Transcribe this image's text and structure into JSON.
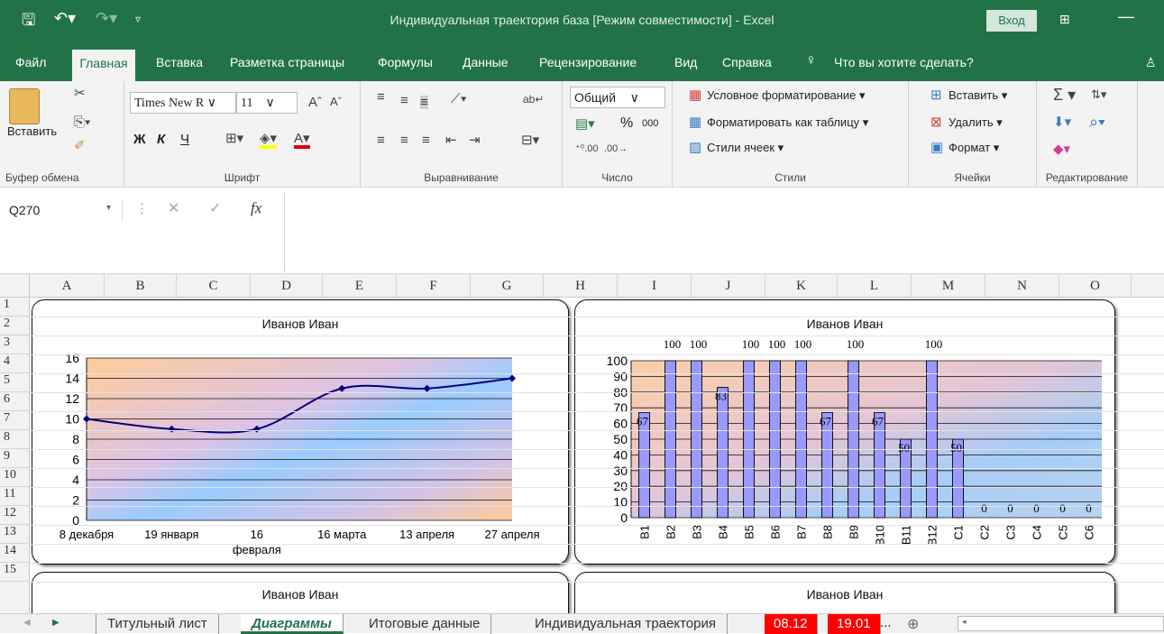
{
  "titlebar": {
    "title": "Индивидуальная траектория база  [Режим совместимости]  -  Excel",
    "login": "Вход"
  },
  "menu": {
    "file": "Файл",
    "home": "Главная",
    "insert": "Вставка",
    "layout": "Разметка страницы",
    "formulas": "Формулы",
    "data": "Данные",
    "review": "Рецензирование",
    "view": "Вид",
    "help": "Справка",
    "tell": "Что вы хотите сделать?"
  },
  "ribbon": {
    "clipboard": {
      "paste": "Вставить",
      "label": "Буфер обмена"
    },
    "font": {
      "name": "Times New R",
      "size": "11",
      "label": "Шрифт",
      "bold": "Ж",
      "italic": "К",
      "underline": "Ч"
    },
    "alignment": {
      "label": "Выравнивание"
    },
    "number": {
      "format": "Общий",
      "label": "Число",
      "percent": "%",
      "thousands": "000"
    },
    "styles": {
      "conditional": "Условное форматирование",
      "table": "Форматировать как таблицу",
      "cell": "Стили ячеек",
      "label": "Стили"
    },
    "cells": {
      "insert": "Вставить",
      "delete": "Удалить",
      "format": "Формат",
      "label": "Ячейки"
    },
    "editing": {
      "label": "Редактирование"
    }
  },
  "formula_bar": {
    "name_box": "Q270",
    "fx": "fx",
    "value": ""
  },
  "columns": [
    "A",
    "B",
    "C",
    "D",
    "E",
    "F",
    "G",
    "H",
    "I",
    "J",
    "K",
    "L",
    "M",
    "N",
    "O"
  ],
  "rows": [
    "1",
    "2",
    "3",
    "4",
    "5",
    "6",
    "7",
    "8",
    "9",
    "10",
    "11",
    "12",
    "13",
    "14",
    "15"
  ],
  "sheets": {
    "tabs": [
      "Титульный лист",
      "Диаграммы",
      "Итоговые данные",
      "Индивидуальная траектория"
    ],
    "active": "Диаграммы",
    "red_tabs": [
      "08.12",
      "19.01"
    ],
    "more": "..."
  },
  "chart_data": [
    {
      "type": "line",
      "title": "Иванов Иван",
      "categories": [
        "8 декабря",
        "19 января",
        "16 февраля",
        "16 марта",
        "13 апреля",
        "27 апреля"
      ],
      "values": [
        10,
        9,
        9,
        13,
        13,
        14
      ],
      "ylim": [
        0,
        16
      ],
      "yticks": [
        0,
        2,
        4,
        6,
        8,
        10,
        12,
        14,
        16
      ],
      "grid": true,
      "color": "#000080"
    },
    {
      "type": "bar",
      "title": "Иванов Иван",
      "categories": [
        "B1",
        "B2",
        "B3",
        "B4",
        "B5",
        "B6",
        "B7",
        "B8",
        "B9",
        "B10",
        "B11",
        "B12",
        "C1",
        "C2",
        "C3",
        "C4",
        "C5",
        "C6"
      ],
      "values": [
        67,
        100,
        100,
        83,
        100,
        100,
        100,
        67,
        100,
        67,
        50,
        100,
        50,
        0,
        0,
        0,
        0,
        0
      ],
      "ylim": [
        0,
        100
      ],
      "yticks": [
        0,
        10,
        20,
        30,
        40,
        50,
        60,
        70,
        80,
        90,
        100
      ],
      "grid": true,
      "color": "#9999ff"
    },
    {
      "type": "line",
      "title": "Иванов Иван"
    },
    {
      "type": "bar",
      "title": "Иванов Иван"
    }
  ]
}
